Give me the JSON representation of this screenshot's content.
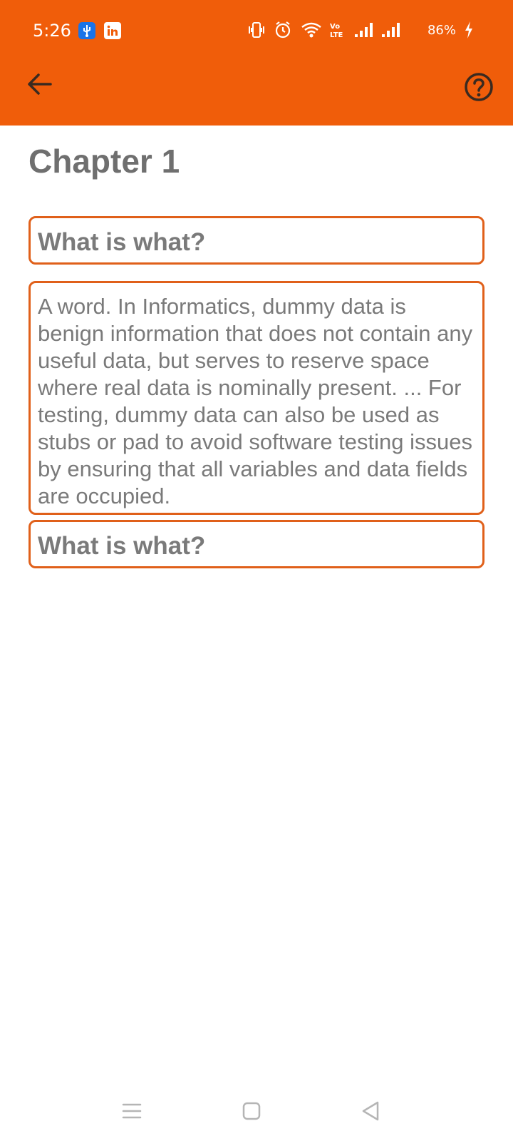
{
  "status_bar": {
    "time": "5:26",
    "battery": "86%",
    "icons": [
      "usb-notification-icon",
      "linkedin-notification-icon",
      "vibrate-icon",
      "alarm-icon",
      "wifi-icon",
      "volte-icon",
      "signal-icon",
      "signal-icon",
      "charging-icon"
    ]
  },
  "app_bar": {
    "icons": [
      "back-arrow-icon",
      "help-icon"
    ]
  },
  "content": {
    "chapter_title": "Chapter 1",
    "cards": [
      {
        "type": "question",
        "text": "What is what?"
      },
      {
        "type": "answer",
        "text": "A word. In Informatics, dummy data is benign information that does not contain any useful data, but serves to reserve space where real data is nominally present. ... For testing, dummy data can also be used as stubs or pad to avoid software testing issues by ensuring that all variables and data fields are occupied."
      },
      {
        "type": "question",
        "text": "What is what?"
      }
    ]
  },
  "nav_bar": {
    "icons": [
      "menu-icon",
      "home-icon",
      "back-icon"
    ]
  },
  "colors": {
    "accent": "#f05d0a",
    "card_border": "#e0601a",
    "text_gray": "#7a7a7a"
  }
}
